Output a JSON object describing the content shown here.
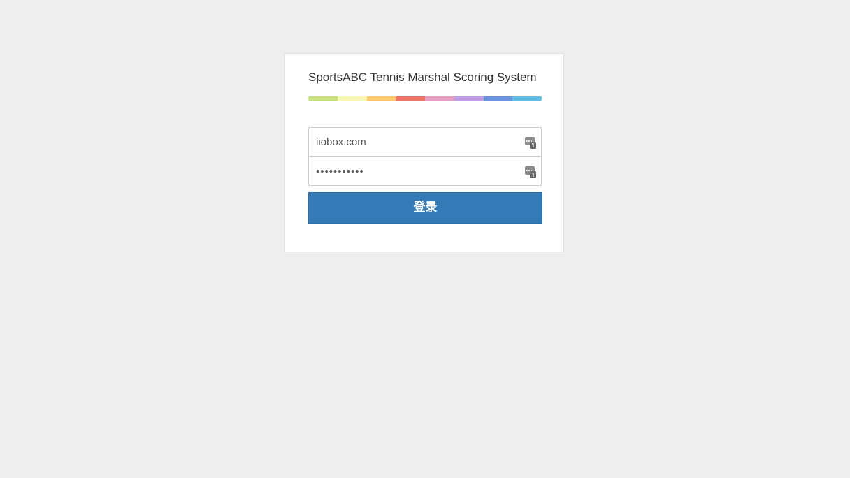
{
  "login": {
    "title": "SportsABC Tennis Marshal Scoring System",
    "stripe_colors": [
      "#c6df7a",
      "#f9f7b8",
      "#fbc86e",
      "#ec7468",
      "#e49ec0",
      "#c39ee4",
      "#6a95de",
      "#62bde2"
    ],
    "username": {
      "value": "iiobox.com",
      "icon": "password-manager-key-icon"
    },
    "password": {
      "value": "•••••••••••",
      "icon": "password-manager-key-icon"
    },
    "submit_label": "登录",
    "accent_color": "#337ab7"
  }
}
